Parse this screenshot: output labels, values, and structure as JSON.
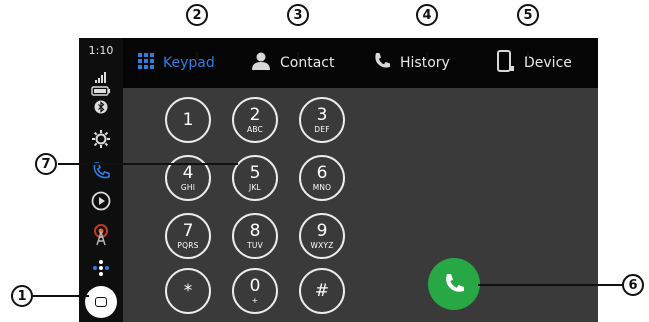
{
  "status": {
    "time": "1:10"
  },
  "tabs": [
    {
      "label": "Keypad",
      "icon": "keypad-grid-icon",
      "active": true
    },
    {
      "label": "Contact",
      "icon": "person-icon",
      "active": false
    },
    {
      "label": "History",
      "icon": "phone-handset-icon",
      "active": false
    },
    {
      "label": "Device",
      "icon": "phone-device-icon",
      "active": false
    }
  ],
  "keypad": {
    "keys": [
      {
        "digit": "1",
        "letters": ""
      },
      {
        "digit": "2",
        "letters": "ABC"
      },
      {
        "digit": "3",
        "letters": "DEF"
      },
      {
        "digit": "4",
        "letters": "GHI"
      },
      {
        "digit": "5",
        "letters": "JKL"
      },
      {
        "digit": "6",
        "letters": "MNO"
      },
      {
        "digit": "7",
        "letters": "PQRS"
      },
      {
        "digit": "8",
        "letters": "TUV"
      },
      {
        "digit": "9",
        "letters": "WXYZ"
      },
      {
        "digit": "*",
        "letters": ""
      },
      {
        "digit": "0",
        "letters": "+"
      },
      {
        "digit": "#",
        "letters": ""
      }
    ]
  },
  "callouts": {
    "c1": "1",
    "c2": "2",
    "c3": "3",
    "c4": "4",
    "c5": "5",
    "c6": "6",
    "c7": "7"
  },
  "colors": {
    "accent": "#2f7de1",
    "call_green": "#27a844",
    "screen_bg": "#3a3a3a",
    "bar_bg": "#050505"
  }
}
